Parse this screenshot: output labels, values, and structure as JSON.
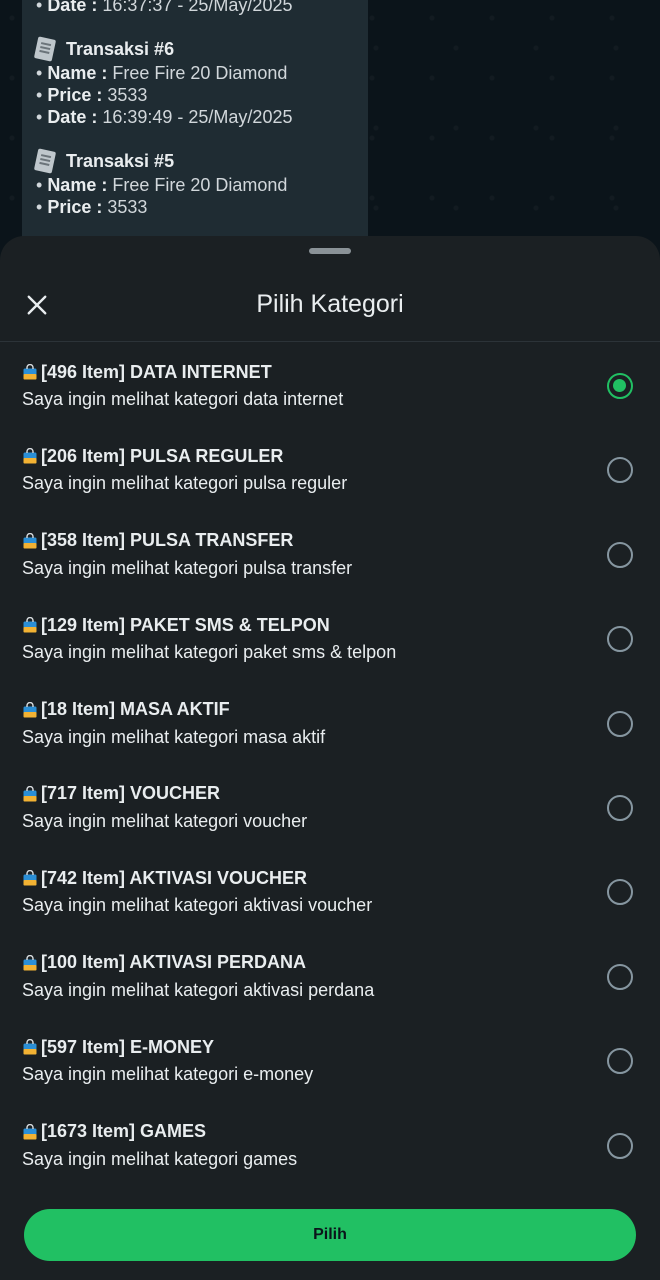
{
  "chat": {
    "top_partial_line": {
      "label": "Date :",
      "value": "16:37:37 - 25/May/2025"
    },
    "transactions": [
      {
        "title": "Transaksi #6",
        "name_label": "Name :",
        "name_value": "Free Fire 20 Diamond",
        "price_label": "Price :",
        "price_value": "3533",
        "date_label": "Date :",
        "date_value": "16:39:49 - 25/May/2025"
      },
      {
        "title": "Transaksi #5",
        "name_label": "Name :",
        "name_value": "Free Fire 20 Diamond",
        "price_label": "Price :",
        "price_value": "3533"
      }
    ]
  },
  "sheet": {
    "title": "Pilih Kategori",
    "items": [
      {
        "title": "[496 Item] DATA INTERNET",
        "desc": "Saya ingin melihat kategori data internet",
        "checked": true
      },
      {
        "title": "[206 Item] PULSA REGULER",
        "desc": "Saya ingin melihat kategori pulsa reguler",
        "checked": false
      },
      {
        "title": "[358 Item] PULSA TRANSFER",
        "desc": "Saya ingin melihat kategori pulsa transfer",
        "checked": false
      },
      {
        "title": "[129 Item] PAKET SMS & TELPON",
        "desc": "Saya ingin melihat kategori paket sms & telpon",
        "checked": false
      },
      {
        "title": "[18 Item] MASA AKTIF",
        "desc": "Saya ingin melihat kategori masa aktif",
        "checked": false
      },
      {
        "title": "[717 Item] VOUCHER",
        "desc": "Saya ingin melihat kategori voucher",
        "checked": false
      },
      {
        "title": "[742 Item] AKTIVASI VOUCHER",
        "desc": "Saya ingin melihat kategori aktivasi voucher",
        "checked": false
      },
      {
        "title": "[100 Item] AKTIVASI PERDANA",
        "desc": "Saya ingin melihat kategori aktivasi perdana",
        "checked": false
      },
      {
        "title": "[597 Item] E-MONEY",
        "desc": "Saya ingin melihat kategori e-money",
        "checked": false
      },
      {
        "title": "[1673 Item] GAMES",
        "desc": "Saya ingin melihat kategori games",
        "checked": false
      }
    ],
    "submit_label": "Pilih"
  },
  "colors": {
    "accent": "#21c063",
    "sheet_bg": "#1b2023",
    "bubble_bg": "#1f2c33"
  },
  "icons": {
    "close": "close-icon",
    "item": "shopping-bag-icon",
    "transaction": "document-icon"
  }
}
